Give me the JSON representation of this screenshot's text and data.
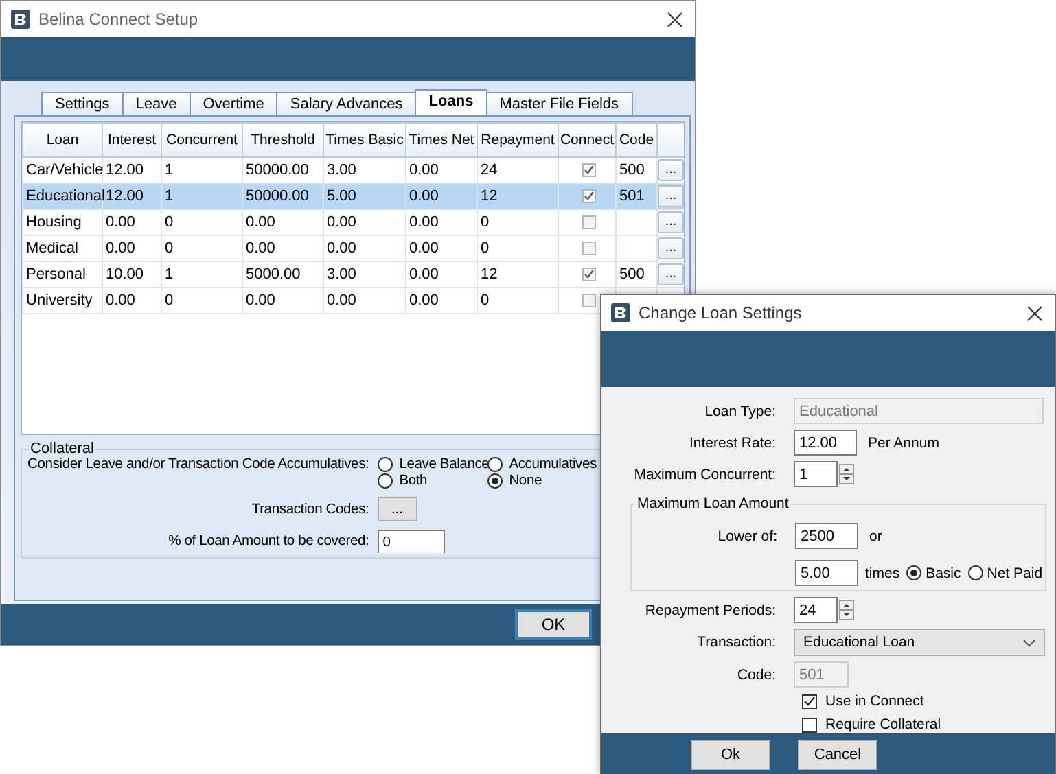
{
  "main_window": {
    "title": "Belina Connect Setup",
    "tabs": [
      {
        "label": "Settings",
        "selected": false
      },
      {
        "label": "Leave",
        "selected": false
      },
      {
        "label": "Overtime",
        "selected": false
      },
      {
        "label": "Salary Advances",
        "selected": false
      },
      {
        "label": "Loans",
        "selected": true
      },
      {
        "label": "Master File Fields",
        "selected": false
      }
    ],
    "table": {
      "columns": [
        "Loan",
        "Interest",
        "Concurrent",
        "Threshold",
        "Times Basic",
        "Times Net",
        "Repayment",
        "Connect",
        "Code"
      ],
      "rows": [
        {
          "loan": "Car/Vehicle",
          "interest": "12.00",
          "concurrent": "1",
          "threshold": "50000.00",
          "times_basic": "3.00",
          "times_net": "0.00",
          "repayment": "24",
          "connect": true,
          "code": "500",
          "button": "...",
          "selected": false
        },
        {
          "loan": "Educational",
          "interest": "12.00",
          "concurrent": "1",
          "threshold": "50000.00",
          "times_basic": "5.00",
          "times_net": "0.00",
          "repayment": "12",
          "connect": true,
          "code": "501",
          "button": "...",
          "selected": true
        },
        {
          "loan": "Housing",
          "interest": "0.00",
          "concurrent": "0",
          "threshold": "0.00",
          "times_basic": "0.00",
          "times_net": "0.00",
          "repayment": "0",
          "connect": false,
          "button": "...",
          "selected": false
        },
        {
          "loan": "Medical",
          "interest": "0.00",
          "concurrent": "0",
          "threshold": "0.00",
          "times_basic": "0.00",
          "times_net": "0.00",
          "repayment": "0",
          "connect": false,
          "button": "...",
          "selected": false
        },
        {
          "loan": "Personal",
          "interest": "10.00",
          "concurrent": "1",
          "threshold": "5000.00",
          "times_basic": "3.00",
          "times_net": "0.00",
          "repayment": "12",
          "connect": true,
          "code": "500",
          "button": "...",
          "selected": false
        },
        {
          "loan": "University",
          "interest": "0.00",
          "concurrent": "0",
          "threshold": "0.00",
          "times_basic": "0.00",
          "times_net": "0.00",
          "repayment": "0",
          "connect": false,
          "selected": false
        }
      ]
    },
    "collateral": {
      "title": "Collateral",
      "consider_label": "Consider Leave and/or Transaction Code Accumulatives:",
      "options": [
        {
          "label": "Leave Balance",
          "selected": false
        },
        {
          "label": "Accumulatives",
          "selected": false
        },
        {
          "label": "Both",
          "selected": false
        },
        {
          "label": "None",
          "selected": true
        }
      ],
      "transaction_codes_label": "Transaction Codes:",
      "transaction_codes_button": "...",
      "percent_label": "% of Loan Amount to be covered:",
      "percent_value": "0"
    },
    "ok_button": "OK"
  },
  "dialog": {
    "title": "Change Loan Settings",
    "loan_type_label": "Loan Type:",
    "loan_type_value": "Educational",
    "interest_label": "Interest  Rate:",
    "interest_value": "12.00",
    "interest_suffix": "Per Annum",
    "max_concurrent_label": "Maximum Concurrent:",
    "max_concurrent_value": "1",
    "max_amount": {
      "title": "Maximum Loan Amount",
      "lower_of_label": "Lower of:",
      "lower_of_value": "2500",
      "or_text": "or",
      "times_value": "5.00",
      "times_text": "times",
      "basis_options": [
        {
          "label": "Basic",
          "selected": true
        },
        {
          "label": "Net Paid",
          "selected": false
        }
      ]
    },
    "repayment_label": "Repayment Periods:",
    "repayment_value": "24",
    "transaction_label": "Transaction:",
    "transaction_value": "Educational Loan",
    "code_label": "Code:",
    "code_value": "501",
    "checkboxes": [
      {
        "label": "Use in Connect",
        "checked": true
      },
      {
        "label": "Require Collateral",
        "checked": false
      }
    ],
    "buttons": [
      "Ok",
      "Cancel"
    ]
  }
}
